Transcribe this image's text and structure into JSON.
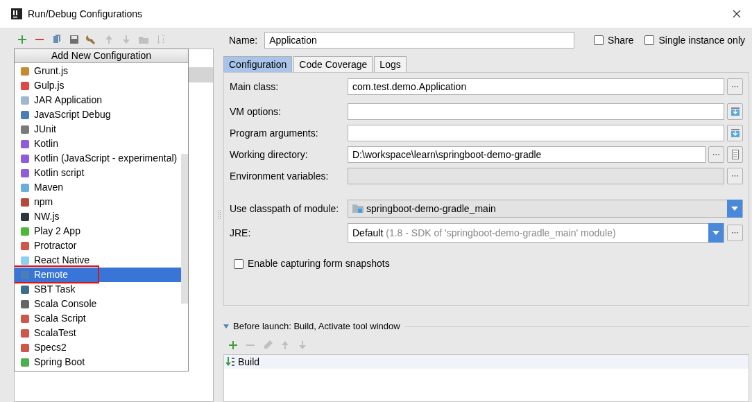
{
  "window": {
    "title": "Run/Debug Configurations"
  },
  "popup": {
    "title": "Add New Configuration",
    "items": [
      {
        "label": "Grunt.js",
        "selected": false
      },
      {
        "label": "Gulp.js",
        "selected": false
      },
      {
        "label": "JAR Application",
        "selected": false
      },
      {
        "label": "JavaScript Debug",
        "selected": false
      },
      {
        "label": "JUnit",
        "selected": false
      },
      {
        "label": "Kotlin",
        "selected": false
      },
      {
        "label": "Kotlin (JavaScript - experimental)",
        "selected": false
      },
      {
        "label": "Kotlin script",
        "selected": false
      },
      {
        "label": "Maven",
        "selected": false
      },
      {
        "label": "npm",
        "selected": false
      },
      {
        "label": "NW.js",
        "selected": false
      },
      {
        "label": "Play 2 App",
        "selected": false
      },
      {
        "label": "Protractor",
        "selected": false
      },
      {
        "label": "React Native",
        "selected": false
      },
      {
        "label": "Remote",
        "selected": true
      },
      {
        "label": "SBT Task",
        "selected": false
      },
      {
        "label": "Scala Console",
        "selected": false
      },
      {
        "label": "Scala Script",
        "selected": false
      },
      {
        "label": "ScalaTest",
        "selected": false
      },
      {
        "label": "Specs2",
        "selected": false
      },
      {
        "label": "Spring Boot",
        "selected": false
      }
    ]
  },
  "name": {
    "label": "Name:",
    "value": "Application"
  },
  "options": [
    {
      "label": "Share",
      "checked": false
    },
    {
      "label": "Single instance only",
      "checked": false
    }
  ],
  "tabs": [
    {
      "label": "Configuration",
      "selected": true
    },
    {
      "label": "Code Coverage",
      "selected": false
    },
    {
      "label": "Logs",
      "selected": false
    }
  ],
  "fields": [
    {
      "label": "Main class:",
      "value": "com.test.demo.Application",
      "kind": "browse",
      "disabled": false
    },
    {
      "label": "VM options:",
      "kind": "expand",
      "disabled": false
    },
    {
      "label": "Program arguments:",
      "kind": "expand",
      "disabled": false
    },
    {
      "label": "Working directory:",
      "value": "D:\\workspace\\learn\\springboot-demo-gradle",
      "kind": "folder",
      "disabled": false
    },
    {
      "label": "Environment variables:",
      "kind": "browse",
      "disabled": true
    }
  ],
  "module": {
    "label": "Use classpath of module:",
    "value": "springboot-demo-gradle_main"
  },
  "jre": {
    "label": "JRE:",
    "value": "Default",
    "detail": "(1.8 - SDK of 'springboot-demo-gradle_main' module)"
  },
  "snapshots": {
    "label": "Enable capturing form snapshots",
    "checked": false
  },
  "before_launch": {
    "title": "Before launch: Build, Activate tool window",
    "expanded": true,
    "tasks": [
      {
        "label": "Build"
      }
    ]
  }
}
